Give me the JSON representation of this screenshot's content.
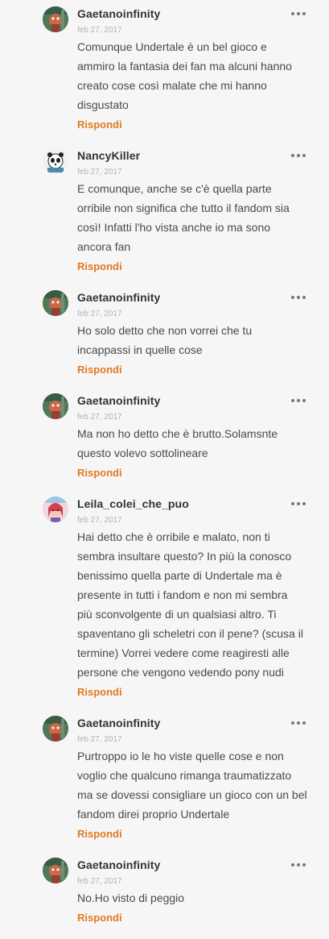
{
  "comments": [
    {
      "author": "Gaetanoinfinity",
      "date": "feb 27, 2017",
      "avatar": "frog-character-avatar",
      "text": "Comunque Undertale è un bel gioco e\nammiro la fantasia dei fan ma alcuni hanno\ncreato cose così malate che mi hanno\ndisgustato",
      "reply_label": "Rispondi"
    },
    {
      "author": "NancyKiller",
      "date": "feb 27, 2017",
      "avatar": "panda-character-avatar",
      "text": "E comunque, anche se c'è quella parte\norribile non significa che tutto il fandom sia\ncosì! Infatti l'ho vista anche io ma sono\nancora fan",
      "reply_label": "Rispondi"
    },
    {
      "author": "Gaetanoinfinity",
      "date": "feb 27, 2017",
      "avatar": "frog-character-avatar",
      "text": "Ho solo detto che non vorrei che tu\nincappassi in quelle cose",
      "reply_label": "Rispondi"
    },
    {
      "author": "Gaetanoinfinity",
      "date": "feb 27, 2017",
      "avatar": "frog-character-avatar",
      "text": "Ma non ho detto che è brutto.Solamsnte\nquesto volevo sottolineare",
      "reply_label": "Rispondi"
    },
    {
      "author": "Leila_colei_che_puo",
      "date": "feb 27, 2017",
      "avatar": "girl-character-avatar",
      "text": "Hai detto che è orribile e malato, non ti\nsembra insultare questo? In più la conosco\nbenissimo quella parte di Undertale ma è\npresente in tutti i fandom e non mi sembra\npiù sconvolgente di un qualsiasi altro. Ti\nspaventano gli scheletri con il pene? (scusa il\ntermine) Vorrei vedere come reagiresti alle\npersone che vengono vedendo pony nudi",
      "reply_label": "Rispondi"
    },
    {
      "author": "Gaetanoinfinity",
      "date": "feb 27, 2017",
      "avatar": "frog-character-avatar",
      "text": "Purtroppo io le ho viste quelle cose e non\nvoglio che qualcuno rimanga traumatizzato\nma se dovessi consigliare un gioco con un bel\nfandom direi proprio Undertale",
      "reply_label": "Rispondi"
    },
    {
      "author": "Gaetanoinfinity",
      "date": "feb 27, 2017",
      "avatar": "frog-character-avatar",
      "text": "No.Ho visto di peggio",
      "reply_label": "Rispondi"
    }
  ],
  "colors": {
    "background": "#f6f6f6",
    "reply_accent": "#e07a1f",
    "date_text": "#b3b3b3",
    "more_icon": "#777777"
  },
  "icons": {
    "more": "more-options-icon"
  }
}
